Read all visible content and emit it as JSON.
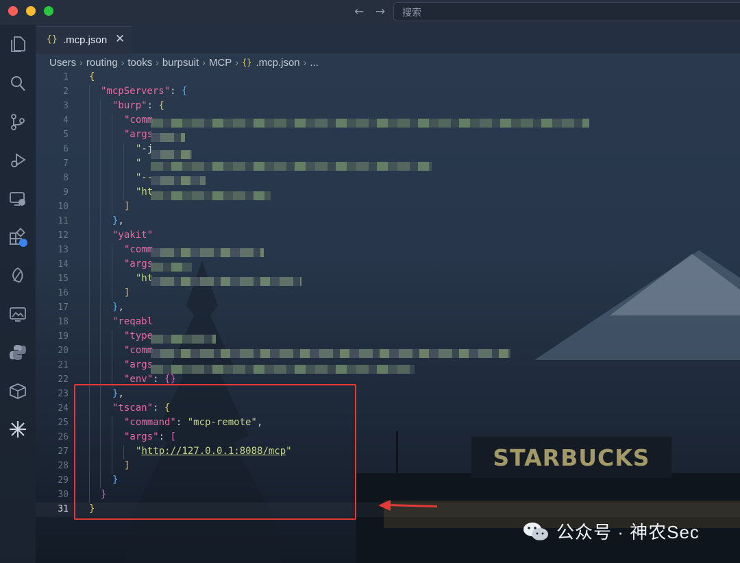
{
  "search": {
    "placeholder": "搜索"
  },
  "nav": {
    "back": "←",
    "forward": "→"
  },
  "tab": {
    "braces": "{}",
    "label": ".mcp.json",
    "close": "✕"
  },
  "breadcrumb": {
    "items": [
      "Users",
      "routing",
      "tooks",
      "burpsuit",
      "MCP",
      ".mcp.json",
      "..."
    ],
    "separator": "›",
    "file_icon": "{}"
  },
  "activity_icons": [
    "files-icon",
    "search-icon",
    "source-control-icon",
    "run-debug-icon",
    "remote-explorer-icon",
    "extensions-icon",
    "leaf-icon",
    "image-preview-icon",
    "python-icon",
    "box-icon",
    "sparkle-icon"
  ],
  "editor": {
    "current_line": 31,
    "lines": [
      {
        "n": "1",
        "t": "{"
      },
      {
        "n": "2",
        "k": "\"mcpServers\"",
        "rest": ": {"
      },
      {
        "n": "3",
        "k": "\"burp\"",
        "rest": ": {"
      },
      {
        "n": "4",
        "k": "\"comm"
      },
      {
        "n": "5",
        "k": "\"args"
      },
      {
        "n": "6",
        "t": "\"-j"
      },
      {
        "n": "7",
        "t": "\""
      },
      {
        "n": "8",
        "t": "\"--"
      },
      {
        "n": "9",
        "t": "\"ht"
      },
      {
        "n": "10",
        "t": "]"
      },
      {
        "n": "11",
        "t": "},"
      },
      {
        "n": "12",
        "k": "\"yakit\""
      },
      {
        "n": "13",
        "k": "\"comm"
      },
      {
        "n": "14",
        "k": "\"args"
      },
      {
        "n": "15",
        "t": "\"ht"
      },
      {
        "n": "16",
        "t": "]"
      },
      {
        "n": "17",
        "t": "},"
      },
      {
        "n": "18",
        "k": "\"reqabl"
      },
      {
        "n": "19",
        "k": "\"type"
      },
      {
        "n": "20",
        "k": "\"comm"
      },
      {
        "n": "21",
        "k": "\"args"
      },
      {
        "n": "22",
        "k": "\"env\"",
        "rest": ": {}"
      },
      {
        "n": "23",
        "t": "},"
      },
      {
        "n": "24",
        "k": "\"tscan\"",
        "rest": ": {"
      },
      {
        "n": "25",
        "k": "\"command\"",
        "v": "\"mcp-remote\""
      },
      {
        "n": "26",
        "k": "\"args\"",
        "rest": ": ["
      },
      {
        "n": "27",
        "url": "http://127.0.0.1:8088/mcp"
      },
      {
        "n": "28",
        "t": "]"
      },
      {
        "n": "29",
        "t": "}"
      },
      {
        "n": "30",
        "t": "}"
      },
      {
        "n": "31",
        "t": "}"
      }
    ]
  },
  "scenery": {
    "sign": "STARBUCKS"
  },
  "watermark": {
    "text": "公众号 · 神农Sec"
  },
  "colors": {
    "highlight": "#e53935",
    "key": "#e96aa4",
    "string": "#c7d88a"
  }
}
